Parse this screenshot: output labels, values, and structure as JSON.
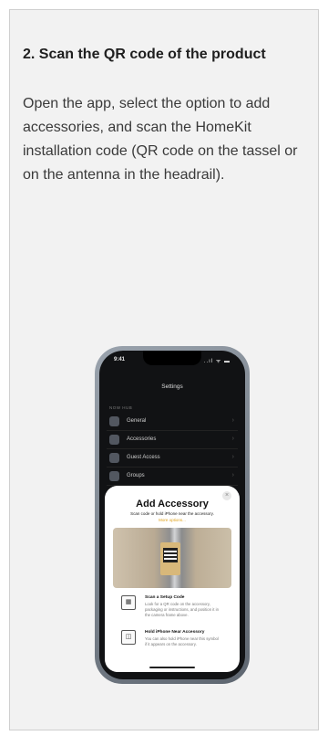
{
  "instruction": {
    "title": "2. Scan the QR code of the product",
    "body": "Open the app, select the option to add accessories, and scan the HomeKit installation code (QR code on the tassel or on the antenna in the headrail)."
  },
  "phone": {
    "status": {
      "time": "9:41",
      "icons": "..ıl ᯤ ▬"
    },
    "settings": {
      "title": "Settings",
      "section": "NOW HUB",
      "rows": [
        {
          "label": "General",
          "icon": "house-icon"
        },
        {
          "label": "Accessories",
          "icon": "grid-icon"
        },
        {
          "label": "Guest Access",
          "icon": "person-icon"
        },
        {
          "label": "Groups",
          "icon": "squares-icon"
        }
      ]
    },
    "sheet": {
      "title": "Add Accessory",
      "subtitle": "Scan code or hold iPhone near the accessory.",
      "link": "More options...",
      "close_label": "×",
      "methods": [
        {
          "icon": "qr-code-icon",
          "title": "Scan a Setup Code",
          "desc": "Look for a QR code on the accessory, packaging or instructions, and position it in the camera frame above."
        },
        {
          "icon": "nfc-icon",
          "title": "Hold iPhone Near Accessory",
          "desc": "You can also hold iPhone near this symbol if it appears on the accessory."
        }
      ]
    }
  }
}
